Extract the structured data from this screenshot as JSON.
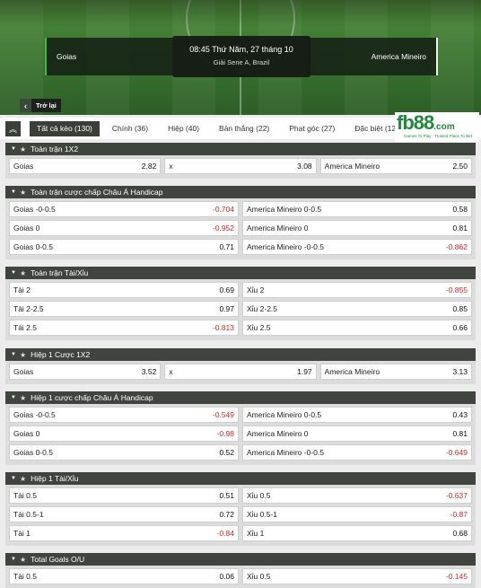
{
  "match": {
    "home": "Goias",
    "away": "America Mineiro",
    "time": "08:45 Thứ Năm, 27 tháng 10",
    "league": "Giải Serie A, Brazil",
    "back_label": "Trở lại"
  },
  "tabs": [
    {
      "label": "Tất cả kèo (130)",
      "active": true
    },
    {
      "label": "Chính (36)"
    },
    {
      "label": "Hiệp (40)"
    },
    {
      "label": "Bàn thắng (22)"
    },
    {
      "label": "Phạt góc (27)"
    },
    {
      "label": "Đặc biệt (12)"
    }
  ],
  "logo": {
    "text_fb": "fb",
    "text_88": "88",
    "text_com": ".com",
    "tagline": "Games To Play · Trusted Place To Bet"
  },
  "sections": [
    {
      "title": "Toàn trận 1X2",
      "type": "three",
      "rows": [
        [
          [
            "Goias",
            "2.82"
          ],
          [
            "x",
            "3.08"
          ],
          [
            "America Mineiro",
            "2.50"
          ]
        ]
      ]
    },
    {
      "title": "Toàn trận cược chấp Châu Á Handicap",
      "type": "two",
      "rows": [
        [
          [
            "Goias -0-0.5",
            "-0.704"
          ],
          [
            "America Mineiro 0-0.5",
            "0.58"
          ]
        ],
        [
          [
            "Goias 0",
            "-0.952"
          ],
          [
            "America Mineiro 0",
            "0.81"
          ]
        ],
        [
          [
            "Goias 0-0.5",
            "0.71"
          ],
          [
            "America Mineiro -0-0.5",
            "-0.862"
          ]
        ]
      ]
    },
    {
      "title": "Toàn trận Tài/Xỉu",
      "type": "two",
      "rows": [
        [
          [
            "Tài 2",
            "0.69"
          ],
          [
            "Xỉu 2",
            "-0.855"
          ]
        ],
        [
          [
            "Tài 2-2.5",
            "0.97"
          ],
          [
            "Xỉu 2-2.5",
            "0.85"
          ]
        ],
        [
          [
            "Tài 2.5",
            "-0.813"
          ],
          [
            "Xỉu 2.5",
            "0.66"
          ]
        ]
      ]
    },
    {
      "title": "Hiệp 1 Cược 1X2",
      "type": "three",
      "rows": [
        [
          [
            "Goias",
            "3.52"
          ],
          [
            "x",
            "1.97"
          ],
          [
            "America Mineiro",
            "3.13"
          ]
        ]
      ]
    },
    {
      "title": "Hiệp 1 cược chấp Châu Á Handicap",
      "type": "two",
      "rows": [
        [
          [
            "Goias -0-0.5",
            "-0.549"
          ],
          [
            "America Mineiro 0-0.5",
            "0.43"
          ]
        ],
        [
          [
            "Goias 0",
            "-0.98"
          ],
          [
            "America Mineiro 0",
            "0.81"
          ]
        ],
        [
          [
            "Goias 0-0.5",
            "0.52"
          ],
          [
            "America Mineiro -0-0.5",
            "-0.649"
          ]
        ]
      ]
    },
    {
      "title": "Hiệp 1 Tài/Xỉu",
      "type": "two",
      "rows": [
        [
          [
            "Tài 0.5",
            "0.51"
          ],
          [
            "Xỉu 0.5",
            "-0.637"
          ]
        ],
        [
          [
            "Tài 0.5-1",
            "0.72"
          ],
          [
            "Xỉu 0.5-1",
            "-0.87"
          ]
        ],
        [
          [
            "Tài 1",
            "-0.84"
          ],
          [
            "Xỉu 1",
            "0.68"
          ]
        ]
      ]
    },
    {
      "title": "Total Goals O/U",
      "type": "two",
      "rows": [
        [
          [
            "Tài 0.5",
            "0.06"
          ],
          [
            "Xỉu 0.5",
            "-0.145"
          ]
        ]
      ]
    }
  ],
  "colors": {
    "negative": "#e02424",
    "header": "#3f443f",
    "accent": "#3dbb3d"
  }
}
